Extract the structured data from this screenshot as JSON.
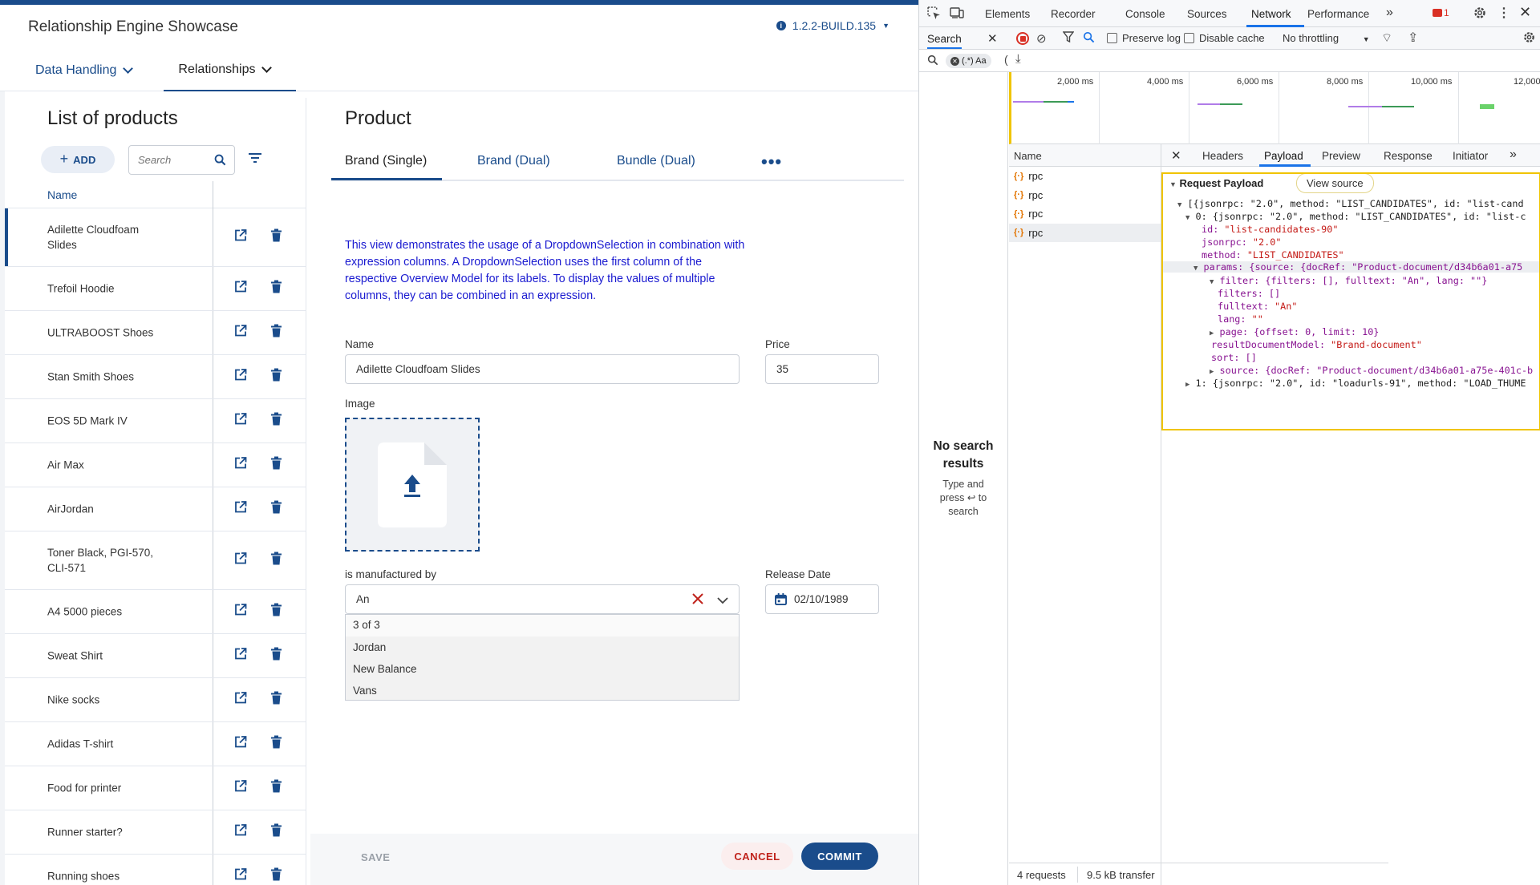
{
  "app": {
    "title": "Relationship Engine Showcase",
    "version": "1.2.2-BUILD.135",
    "nav": [
      {
        "label": "Data Handling"
      },
      {
        "label": "Relationships"
      }
    ]
  },
  "list": {
    "title": "List of products",
    "add_label": "ADD",
    "search_placeholder": "Search",
    "column_name": "Name",
    "rows": [
      {
        "label": "Adilette Cloudfoam Slides",
        "selected": true
      },
      {
        "label": "Trefoil Hoodie"
      },
      {
        "label": "ULTRABOOST Shoes"
      },
      {
        "label": "Stan Smith Shoes"
      },
      {
        "label": "EOS 5D Mark IV"
      },
      {
        "label": "Air Max"
      },
      {
        "label": "AirJordan"
      },
      {
        "label": "Toner Black, PGI-570, CLI-571"
      },
      {
        "label": "A4 5000 pieces"
      },
      {
        "label": "Sweat Shirt"
      },
      {
        "label": "Nike socks"
      },
      {
        "label": "Adidas T-shirt"
      },
      {
        "label": "Food for printer"
      },
      {
        "label": "Runner starter?"
      },
      {
        "label": "Running shoes"
      }
    ]
  },
  "product": {
    "title": "Product",
    "tabs": [
      {
        "label": "Brand (Single)"
      },
      {
        "label": "Brand (Dual)"
      },
      {
        "label": "Bundle (Dual)"
      }
    ],
    "more_label": "•••",
    "description": "This view demonstrates the usage of a DropdownSelection in combination with expression columns. A DropdownSelection uses the first column of the respective Overview Model for its labels. To display the values of multiple columns, they can be combined in an expression.",
    "name_label": "Name",
    "name_value": "Adilette Cloudfoam Slides",
    "price_label": "Price",
    "price_value": "35",
    "image_label": "Image",
    "manufacturer_label": "is manufactured by",
    "manufacturer_value": "An",
    "dropdown": {
      "count": "3 of 3",
      "options": [
        "Jordan",
        "New Balance",
        "Vans"
      ]
    },
    "release_label": "Release Date",
    "release_value": "02/10/1989",
    "save_label": "SAVE",
    "cancel_label": "CANCEL",
    "commit_label": "COMMIT"
  },
  "devtools": {
    "tabs": [
      "Elements",
      "Recorder",
      "Console",
      "Sources",
      "Network",
      "Performance"
    ],
    "error_count": "1",
    "search_label": "Search",
    "preserve_log": "Preserve log",
    "disable_cache": "Disable cache",
    "throttling": "No throttling",
    "regex_label": "(.*) Aa",
    "no_results_title": "No search results",
    "no_results_hint": "Type and press ↩ to search",
    "timeline_labels": [
      "2,000 ms",
      "4,000 ms",
      "6,000 ms",
      "8,000 ms",
      "10,000 ms",
      "12,000"
    ],
    "name_header": "Name",
    "requests": [
      "rpc",
      "rpc",
      "rpc",
      "rpc"
    ],
    "detail_tabs": [
      "Headers",
      "Payload",
      "Preview",
      "Response",
      "Initiator"
    ],
    "payload_title": "Request Payload",
    "view_source": "View source",
    "payload_lines": {
      "l1": "[{jsonrpc: \"2.0\", method: \"LIST_CANDIDATES\", id: \"list-cand",
      "l2": "0: {jsonrpc: \"2.0\", method: \"LIST_CANDIDATES\", id: \"list-c",
      "id_k": "id: ",
      "id_v": "\"list-candidates-90\"",
      "jsonrpc_k": "jsonrpc: ",
      "jsonrpc_v": "\"2.0\"",
      "method_k": "method: ",
      "method_v": "\"LIST_CANDIDATES\"",
      "params": "params: {source: {docRef: \"Product-document/d34b6a01-a75",
      "filter": "filter: {filters: [], fulltext: \"An\", lang: \"\"}",
      "filters": "filters: []",
      "fulltext_k": "fulltext: ",
      "fulltext_v": "\"An\"",
      "lang_k": "lang: ",
      "lang_v": "\"\"",
      "page": "page: {offset: 0, limit: 10}",
      "rdm_k": "resultDocumentModel: ",
      "rdm_v": "\"Brand-document\"",
      "sort": "sort: []",
      "source": "source: {docRef: \"Product-document/d34b6a01-a75e-401c-b",
      "l1b": "1: {jsonrpc: \"2.0\", id: \"loadurls-91\", method: \"LOAD_THUME"
    },
    "footer_requests": "4 requests",
    "footer_transfer": "9.5 kB transfer"
  }
}
